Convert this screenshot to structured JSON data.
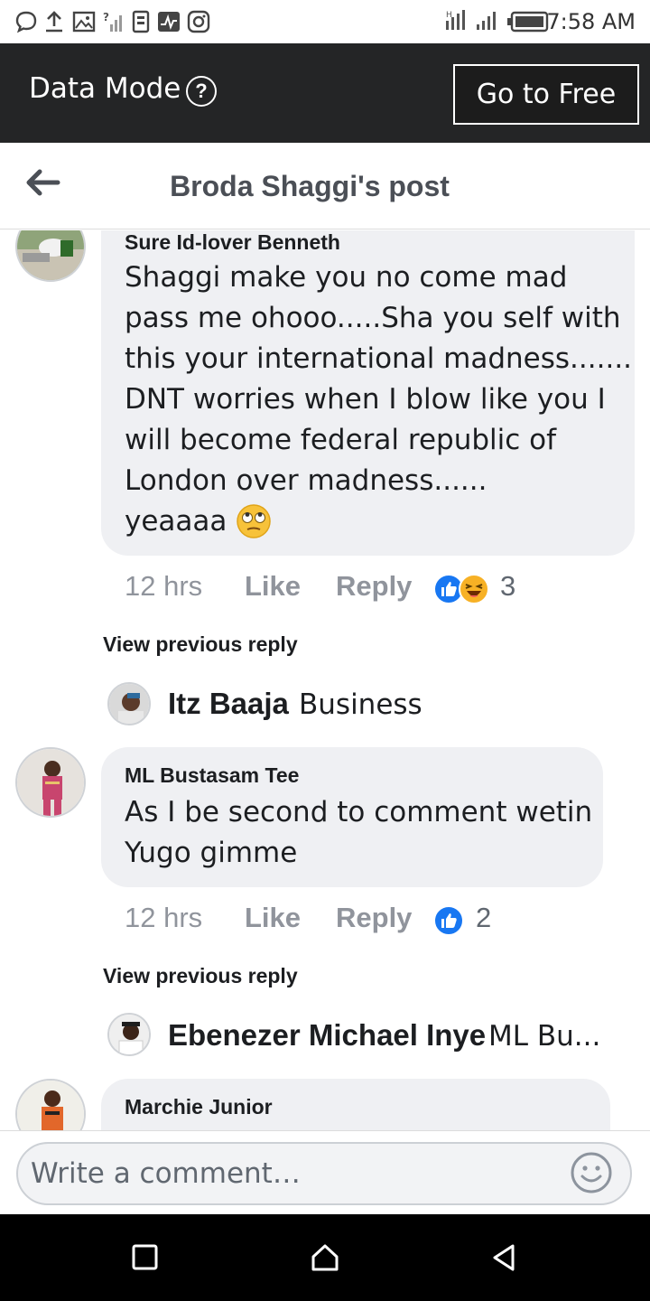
{
  "status_bar": {
    "time": "7:58 AM"
  },
  "data_bar": {
    "title": "Data Mode",
    "help_glyph": "?",
    "go_free_label": "Go to Free"
  },
  "header": {
    "title": "Broda Shaggi's post"
  },
  "comments": [
    {
      "author": "Sure Id-lover Benneth",
      "lines": [
        "Shaggi make you no come mad",
        "pass me ohooo.....Sha you self with",
        "this your international madness.......",
        "DNT worries when I blow like you I",
        "will become federal republic of",
        "London over madness......",
        "yeaaaa"
      ],
      "time": "12 hrs",
      "like_label": "Like",
      "reply_label": "Reply",
      "reaction_count": "3"
    },
    {
      "author": "ML Bustasam Tee",
      "lines": [
        "As I be second to comment wetin",
        "Yugo gimme"
      ],
      "time": "12 hrs",
      "like_label": "Like",
      "reply_label": "Reply",
      "reaction_count": "2"
    },
    {
      "author": "Marchie Junior"
    }
  ],
  "replies": [
    {
      "view_previous": "View previous reply",
      "name": "Itz Baaja",
      "text": "Business"
    },
    {
      "view_previous": "View previous reply",
      "name": "Ebenezer Michael Inye",
      "text": "ML Bu..."
    }
  ],
  "composer": {
    "placeholder": "Write a comment…"
  },
  "colors": {
    "data_bar_bg": "#242526",
    "bubble_bg": "#eff0f3",
    "like_blue": "#1877f2",
    "haha_yellow": "#f7b125"
  },
  "icons": [
    "message-icon",
    "upload-icon",
    "image-icon",
    "signal-icon",
    "sim-icon",
    "activity-icon",
    "instagram-icon",
    "battery-icon",
    "back-arrow-icon",
    "help-icon",
    "like-reaction-icon",
    "haha-reaction-icon",
    "rolling-eyes-emoji-icon",
    "emoji-icon",
    "square-nav-icon",
    "home-nav-icon",
    "back-nav-icon"
  ]
}
